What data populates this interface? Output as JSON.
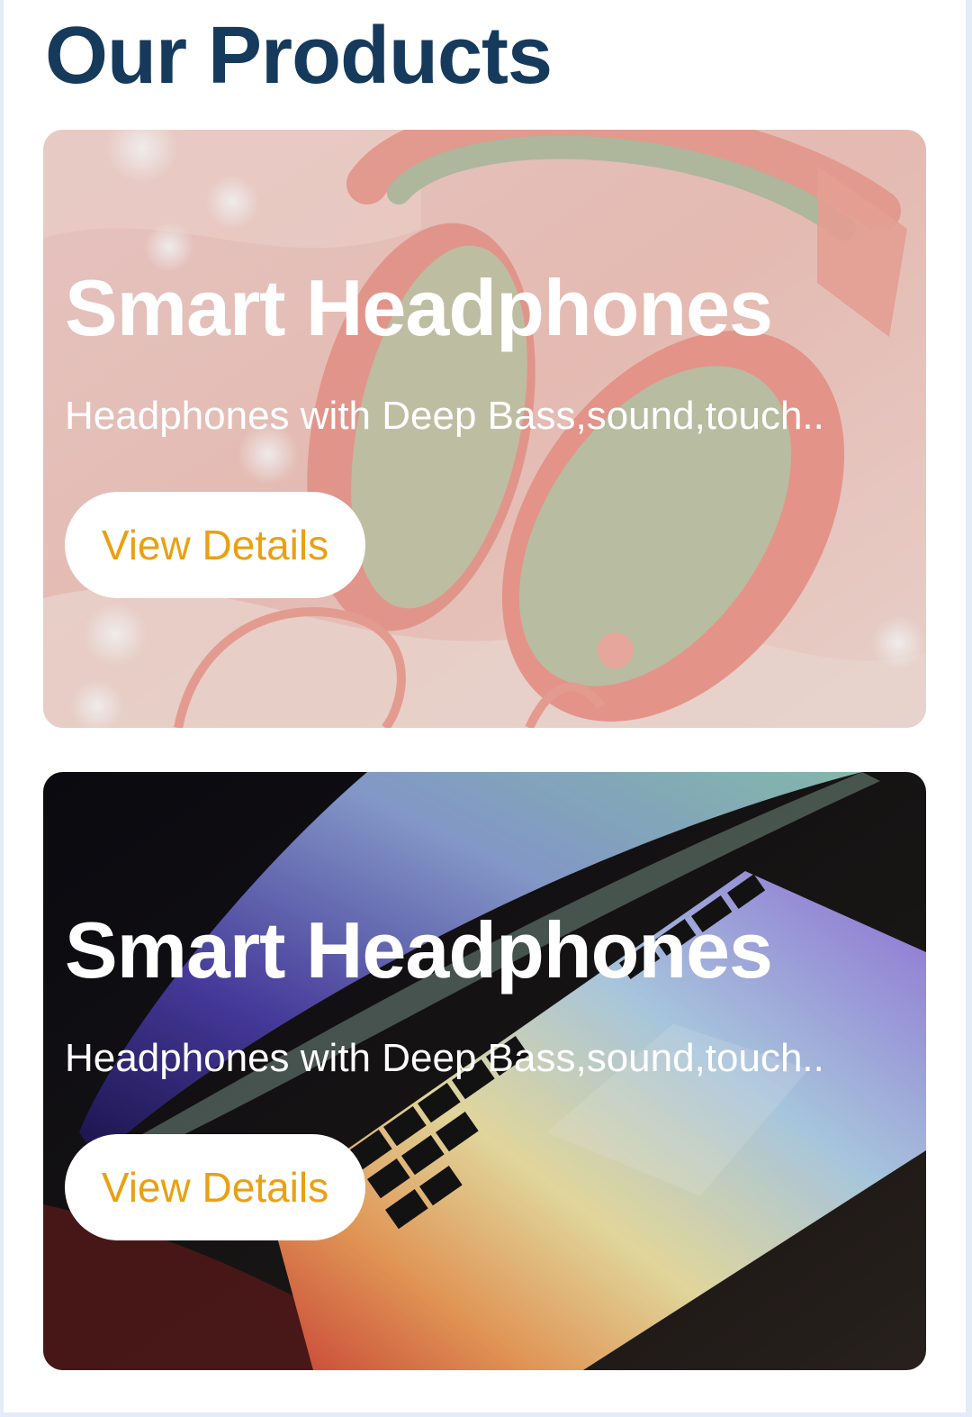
{
  "page": {
    "title": "Our Products"
  },
  "products": [
    {
      "name": "Smart Headphones",
      "description": "Headphones with Deep Bass,sound,touch..",
      "button_label": "View Details"
    },
    {
      "name": "Smart Headphones",
      "description": "Headphones with Deep Bass,sound,touch..",
      "button_label": "View Details"
    }
  ],
  "colors": {
    "title": "#163a5c",
    "button_text": "#eba012",
    "button_bg": "#ffffff",
    "card_text": "#ffffff"
  }
}
